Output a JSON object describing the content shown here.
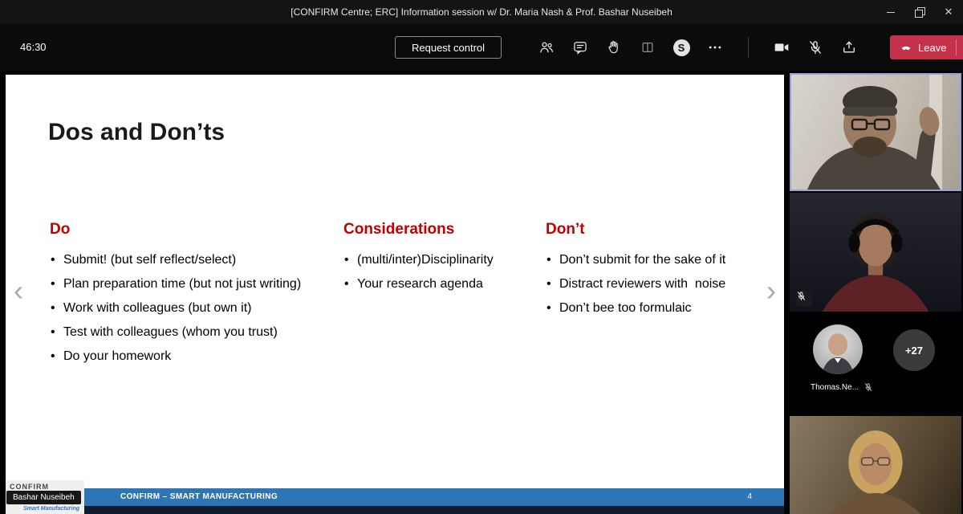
{
  "palette": {
    "heading_red": "#c00000",
    "footer_blue": "#2e75b6",
    "footer_dark": "#101c30",
    "leave_red": "#c4314b",
    "active_speaker_border": "#9b9ddf"
  },
  "titlebar": {
    "title": "[CONFIRM Centre; ERC] Information session w/ Dr. Maria Nash & Prof. Bashar Nuseibeh"
  },
  "toolbar": {
    "timer": "46:30",
    "request_control": "Request control",
    "leave": "Leave"
  },
  "icons": {
    "close_glyph": "✕",
    "skype_glyph": "S",
    "prev_glyph": "‹",
    "next_glyph": "›"
  },
  "slide": {
    "title": "Dos and Don’ts",
    "columns": [
      {
        "heading": "Do",
        "items": [
          "Submit! (but self reflect/select)",
          "Plan preparation time (but not just writing)",
          "Work with colleagues (but own it)",
          "Test with colleagues (whom you trust)",
          "Do your homework"
        ]
      },
      {
        "heading": "Considerations",
        "items": [
          "(multi/inter)Disciplinarity",
          "Your research agenda"
        ]
      },
      {
        "heading": "Don’t",
        "items": [
          "Don’t submit for the sake of it",
          "Distract reviewers with  noise",
          "Don’t bee too formulaic"
        ]
      }
    ],
    "footer_text": "CONFIRM – SMART MANUFACTURING",
    "page_number": "4",
    "presenter_name": "Bashar Nuseibeh",
    "logo_title": "CONFIRM",
    "logo_subtitle": "Smart Manufacturing"
  },
  "sidebar": {
    "participant_name": "Thomas.Ne...",
    "overflow_badge": "+27"
  }
}
